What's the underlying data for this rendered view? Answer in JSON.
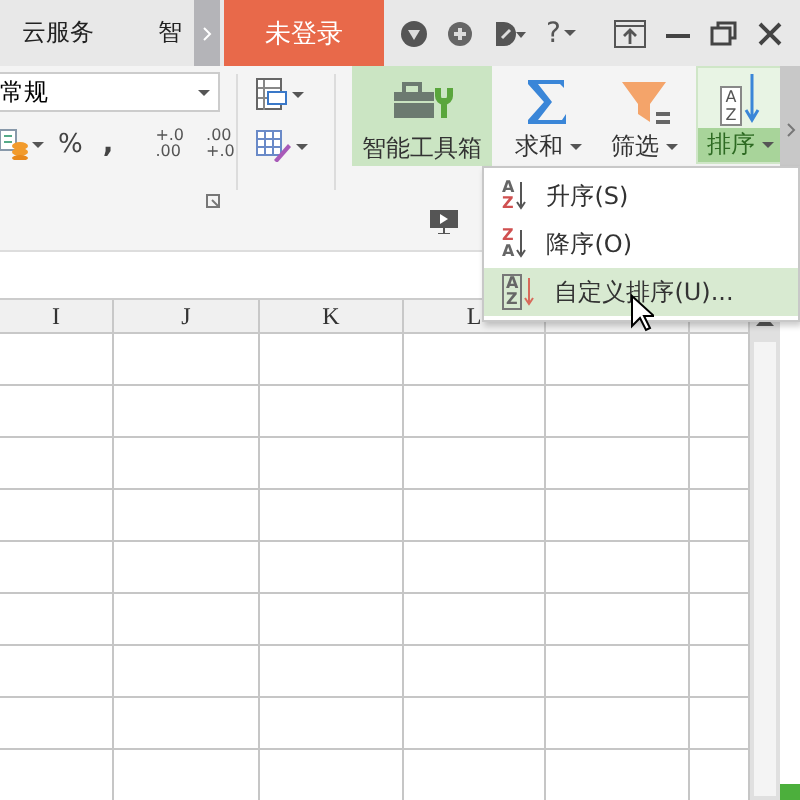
{
  "title_bar": {
    "tabs": [
      {
        "label": "云服务",
        "selected": false
      },
      {
        "label": "智",
        "selected": false
      }
    ],
    "login_button": "未登录",
    "help": "?"
  },
  "ribbon": {
    "number_format": {
      "value": "常规"
    },
    "percent": "%",
    "comma": ",",
    "decimal_buttons": [
      {
        "top": "+.0",
        "bottom": ".00"
      },
      {
        "top": ".00",
        "bottom": "+.0"
      }
    ],
    "big_buttons": [
      {
        "label": "智能工具箱",
        "kind": "toolbox",
        "selected": true,
        "dropdown": false
      },
      {
        "label": "求和",
        "kind": "sum",
        "selected": false,
        "dropdown": true
      },
      {
        "label": "筛选",
        "kind": "filter",
        "selected": false,
        "dropdown": true
      },
      {
        "label": "排序",
        "kind": "sort",
        "selected": true,
        "dropdown": true,
        "letters": [
          "A",
          "Z"
        ]
      }
    ]
  },
  "sort_menu": [
    {
      "label": "升序(S)",
      "kind": "asc",
      "selected": false,
      "letters": [
        "A",
        "Z"
      ]
    },
    {
      "label": "降序(O)",
      "kind": "desc",
      "selected": false,
      "letters": [
        "Z",
        "A"
      ]
    },
    {
      "label": "自定义排序(U)...",
      "kind": "custom",
      "selected": true,
      "letters": [
        "A",
        "Z"
      ]
    }
  ],
  "sheet": {
    "columns": [
      "I",
      "J",
      "K",
      "L"
    ]
  }
}
